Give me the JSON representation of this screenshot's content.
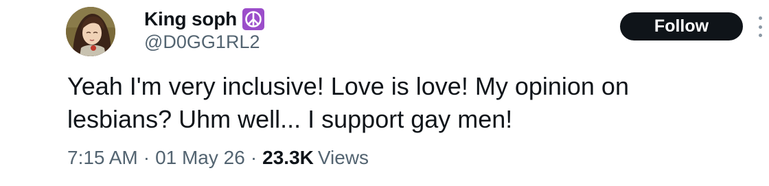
{
  "author": {
    "display_name": "King soph",
    "badge_icon": "peace-symbol-icon",
    "badge_color": "#9b4dca",
    "handle": "@D0GG1RL2"
  },
  "actions": {
    "follow_label": "Follow",
    "more_icon": "vertical-ellipsis-icon"
  },
  "tweet": {
    "text": "Yeah I'm very inclusive! Love is love! My opinion on lesbians? Uhm well... I support gay men!"
  },
  "meta": {
    "time": "7:15 AM",
    "date": "01 May 26",
    "separator": "·",
    "views_count": "23.3K",
    "views_label": "Views"
  },
  "colors": {
    "text": "#0f1419",
    "secondary": "#536471",
    "button_bg": "#0f1419",
    "button_text": "#ffffff"
  }
}
